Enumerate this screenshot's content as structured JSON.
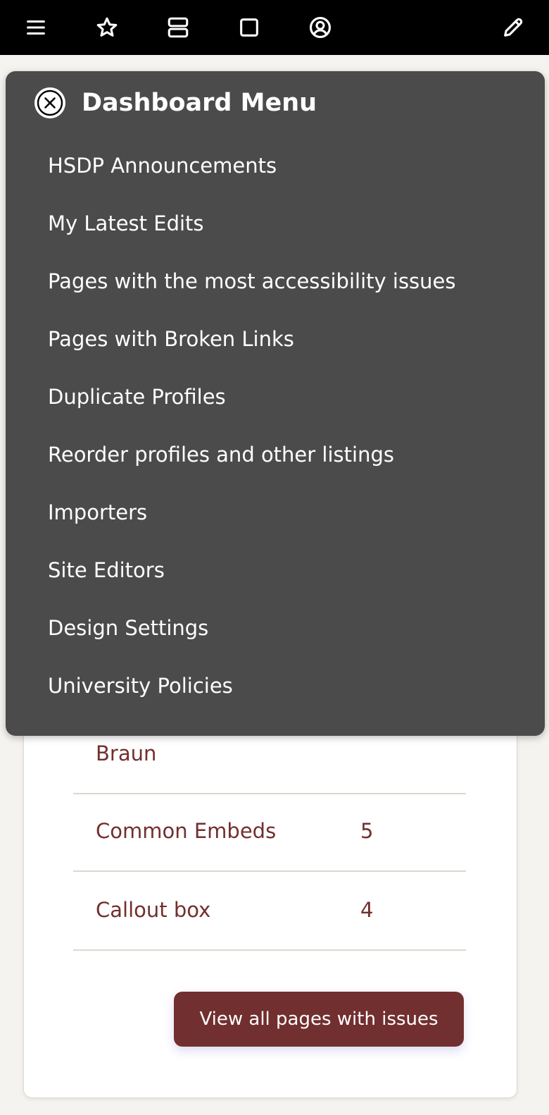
{
  "toolbar": {
    "icons": [
      "menu-icon",
      "star-icon",
      "layout-icon",
      "square-icon",
      "user-icon",
      "pencil-icon"
    ]
  },
  "dashboard_menu": {
    "title": "Dashboard Menu",
    "close_icon": "close-circle-icon",
    "items": [
      {
        "label": "HSDP Announcements"
      },
      {
        "label": "My Latest Edits"
      },
      {
        "label": "Pages with the most accessibility issues"
      },
      {
        "label": "Pages with Broken Links"
      },
      {
        "label": "Duplicate Profiles"
      },
      {
        "label": "Reorder profiles and other listings"
      },
      {
        "label": "Importers"
      },
      {
        "label": "Site Editors"
      },
      {
        "label": "Design Settings"
      },
      {
        "label": "University Policies"
      }
    ]
  },
  "issues_card": {
    "rows": [
      {
        "name": "Braun",
        "count": ""
      },
      {
        "name": "Common Embeds",
        "count": "5"
      },
      {
        "name": "Callout box",
        "count": "4"
      }
    ],
    "view_all_label": "View all pages with issues"
  },
  "colors": {
    "toolbar_bg": "#000000",
    "menu_bg": "#4b4b4b",
    "accent": "#722f2f",
    "page_bg": "#f5f3ef"
  }
}
